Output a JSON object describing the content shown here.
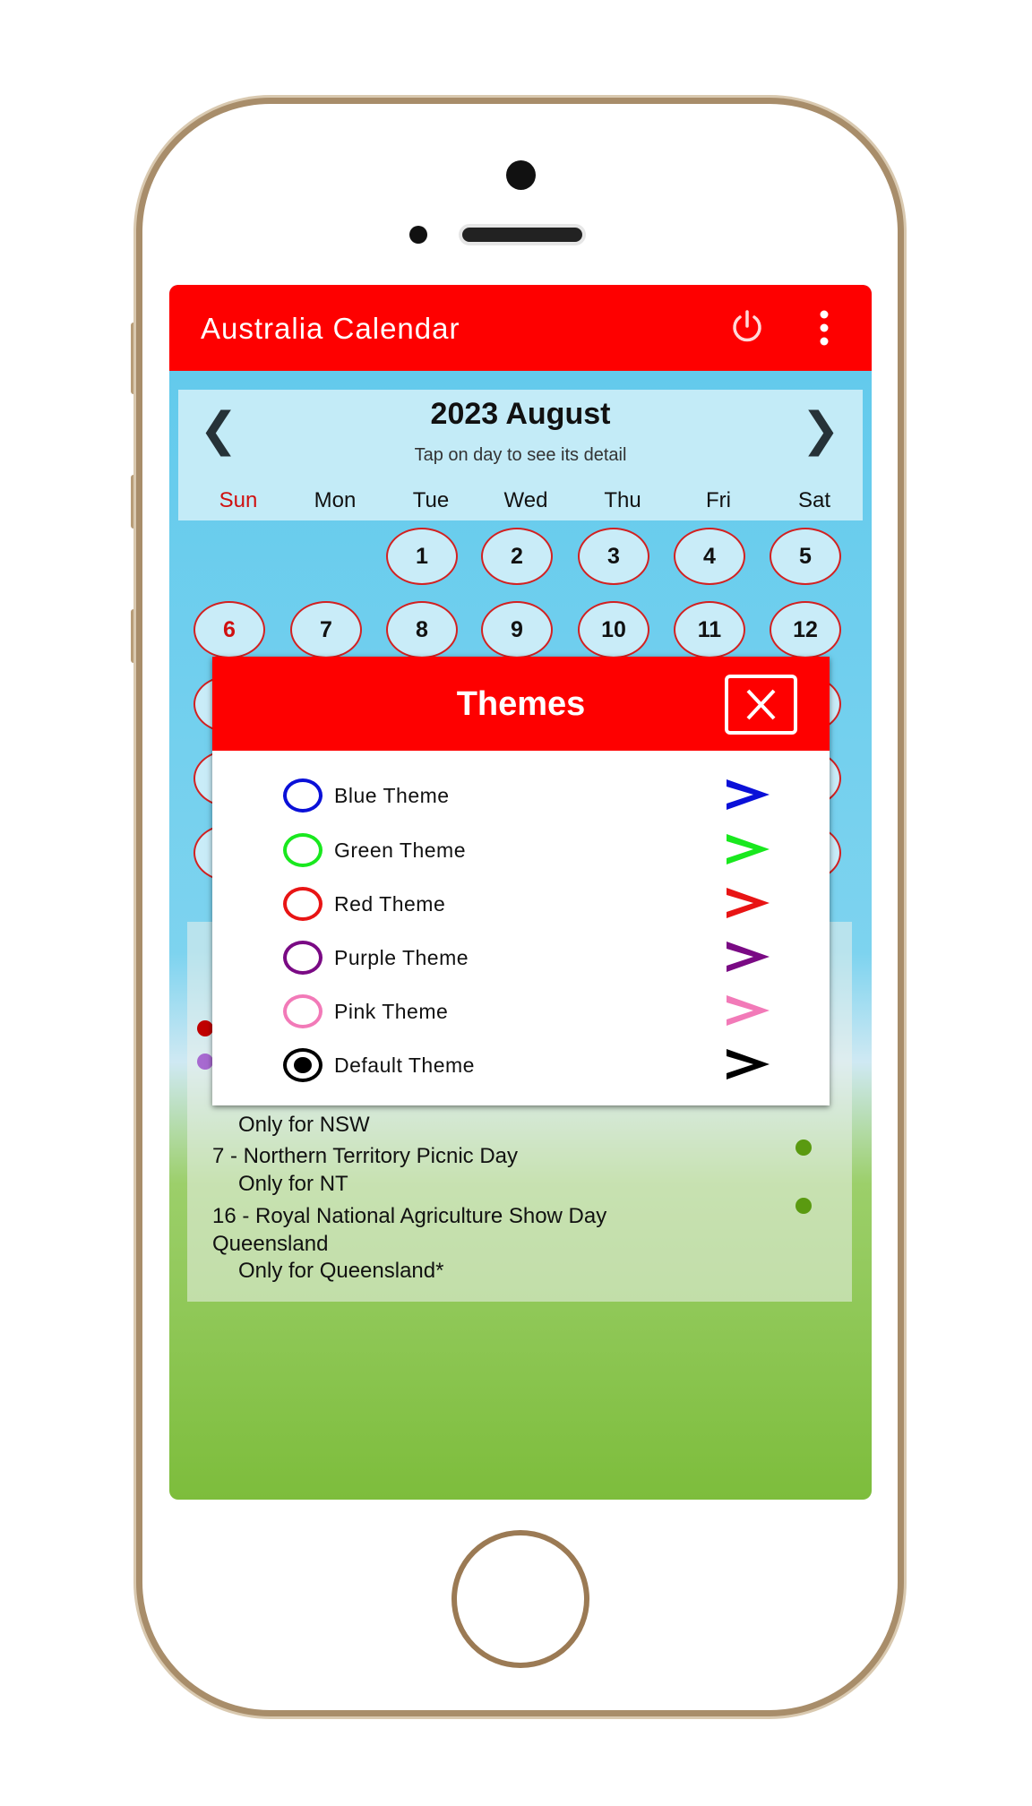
{
  "app": {
    "title": "Australia Calendar",
    "power_icon": "power-icon",
    "menu_icon": "more-vert-icon",
    "accent": "#fe0000"
  },
  "calendar": {
    "month_label": "2023 August",
    "hint": "Tap on day to see its detail",
    "weekdays": [
      "Sun",
      "Mon",
      "Tue",
      "Wed",
      "Thu",
      "Fri",
      "Sat"
    ],
    "week1": [
      "",
      "",
      "1",
      "2",
      "3",
      "4",
      "5"
    ],
    "week2": [
      "6",
      "7",
      "8",
      "9",
      "10",
      "11",
      "12"
    ]
  },
  "holidays": {
    "lines": [
      "Only for NSW",
      "7 - Northern Territory Picnic Day",
      "Only for NT",
      "16 - Royal National Agriculture Show Day",
      "Queensland",
      "Only for Queensland*"
    ]
  },
  "themes_dialog": {
    "title": "Themes",
    "close_icon": "close-icon",
    "options": [
      {
        "label": "Blue Theme",
        "color": "#0a10d8",
        "selected": false
      },
      {
        "label": "Green Theme",
        "color": "#19e81e",
        "selected": false
      },
      {
        "label": "Red Theme",
        "color": "#e81414",
        "selected": false
      },
      {
        "label": "Purple Theme",
        "color": "#7a0a84",
        "selected": false
      },
      {
        "label": "Pink Theme",
        "color": "#f27ab8",
        "selected": false
      },
      {
        "label": "Default Theme",
        "color": "#000000",
        "selected": true
      }
    ]
  }
}
